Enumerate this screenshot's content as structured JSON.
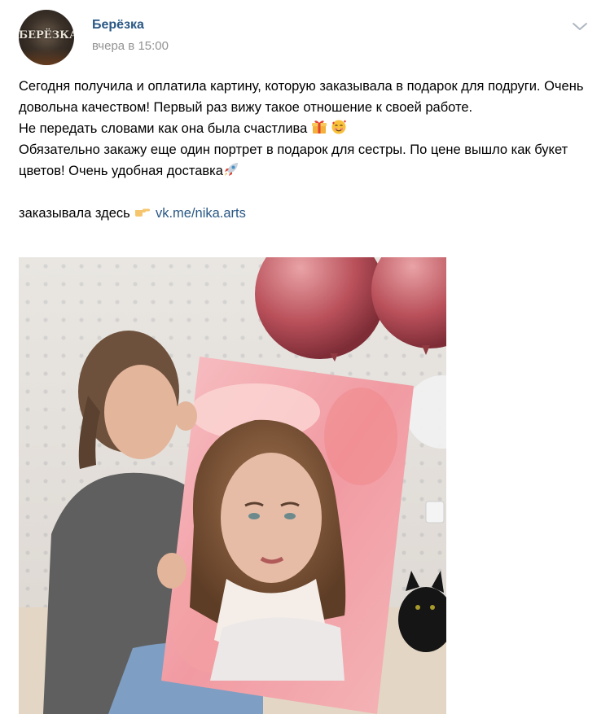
{
  "author": {
    "name": "Берёзка",
    "avatar_text": "БЕРЁЗКА",
    "date": "вчера в 15:00"
  },
  "post": {
    "lines": [
      "Сегодня получила и оплатила картину, которую заказывала в подарок для подруги. Очень довольна качеством! Первый раз вижу такое отношение к своей работе.",
      "Не передать словами как она была счастлива",
      "Обязательно закажу еще один портрет в подарок для сестры. По цене вышло как букет цветов! Очень удобная доставка"
    ],
    "order_prefix": "заказывала здесь",
    "link_text": "vk.me/nika.arts"
  },
  "icons": {
    "menu": "chevron-down-icon",
    "gift": "gift-emoji-icon",
    "smile": "smiling-face-with-hearts-emoji-icon",
    "rocket": "rocket-emoji-icon",
    "hand": "pointing-right-emoji-icon"
  },
  "colors": {
    "link": "#2a5885",
    "date": "#939393",
    "text": "#000000"
  }
}
